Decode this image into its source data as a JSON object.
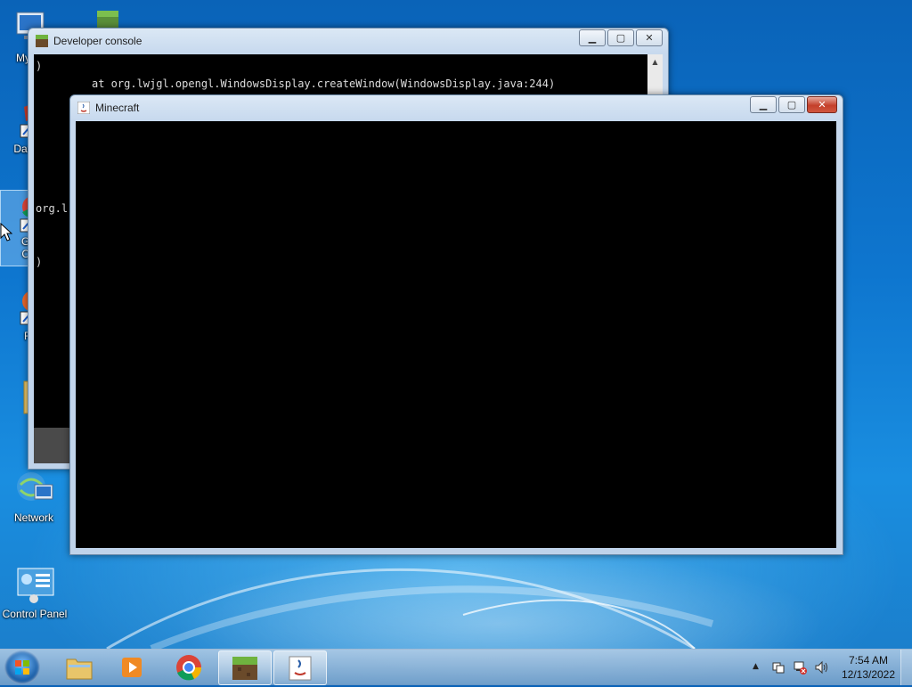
{
  "desktop": {
    "icons": [
      {
        "label": "My C"
      },
      {
        "label": "DataV"
      },
      {
        "label": "Go"
      },
      {
        "label": "Ch"
      },
      {
        "label": "Fi"
      },
      {
        "label": "Network"
      },
      {
        "label": "Control Panel"
      }
    ]
  },
  "console": {
    "title": "Developer console",
    "lines": [
      ")",
      "at org.lwjgl.opengl.WindowsDisplay.createWindow(WindowsDisplay.java:244)",
      "org.l",
      ")"
    ]
  },
  "minecraft": {
    "title": "Minecraft"
  },
  "taskbar": {
    "time": "7:54 AM",
    "date": "12/13/2022",
    "tray_expand": "▲"
  },
  "colors": {
    "titlebar": "#c7d9ee",
    "close": "#c4402b",
    "console_bg": "#000000"
  }
}
